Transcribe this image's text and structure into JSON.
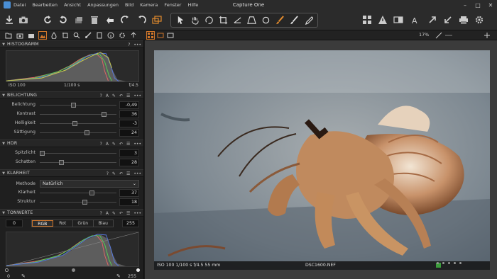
{
  "app": {
    "title": "Capture One"
  },
  "menu": [
    "Datei",
    "Bearbeiten",
    "Ansicht",
    "Anpassungen",
    "Bild",
    "Kamera",
    "Fenster",
    "Hilfe"
  ],
  "window_controls": {
    "minimize": "–",
    "maximize": "□",
    "close": "✕"
  },
  "toolbar": {
    "left_icons": [
      "import-icon",
      "camera-icon",
      "undo-icon",
      "redo-icon",
      "copy-icon",
      "trash-icon",
      "copy-adjustments-icon",
      "apply-adjustments-icon",
      "reset-icon",
      "apply-all-icon",
      "variants-icon"
    ],
    "cursor_tools": [
      "pointer-icon",
      "pan-icon",
      "rotate-icon",
      "crop-icon",
      "straighten-icon",
      "keystone-icon",
      "spot-icon",
      "circle-icon",
      "brush-icon",
      "eraser-icon",
      "picker-icon"
    ],
    "right_icons": [
      "grid-icon",
      "warning-icon",
      "compare-icon",
      "text-icon",
      "expand-icon",
      "collapse-icon",
      "print-icon",
      "settings-icon"
    ]
  },
  "toolstrip": {
    "tabs": [
      "folder-icon",
      "capture-icon",
      "camera-icon",
      "exposure-icon",
      "color-icon",
      "lens-icon",
      "crop-icon",
      "search-icon",
      "brush-icon",
      "clipboard-icon",
      "info-icon",
      "gear-icon",
      "export-icon",
      "more-icon"
    ],
    "zoom": "17%"
  },
  "histogram_section": {
    "title": "HISTOGRAMM",
    "iso": "ISO 100",
    "shutter": "1/100 s",
    "aperture": "f/4.5"
  },
  "exposure": {
    "title": "BELICHTUNG",
    "rows": [
      {
        "label": "Belichtung",
        "value": "-0,49",
        "pos": 0.44
      },
      {
        "label": "Kontrast",
        "value": "36",
        "pos": 0.84
      },
      {
        "label": "Helligkeit",
        "value": "-3",
        "pos": 0.46
      },
      {
        "label": "Sättigung",
        "value": "24",
        "pos": 0.62
      }
    ]
  },
  "hdr": {
    "title": "HDR",
    "rows": [
      {
        "label": "Spitzlicht",
        "value": "3",
        "pos": 0.03
      },
      {
        "label": "Schatten",
        "value": "28",
        "pos": 0.28
      }
    ]
  },
  "clarity": {
    "title": "KLARHEIT",
    "method_label": "Methode",
    "method_value": "Natürlich",
    "rows": [
      {
        "label": "Klarheit",
        "value": "37",
        "pos": 0.68
      },
      {
        "label": "Struktur",
        "value": "18",
        "pos": 0.59
      }
    ]
  },
  "levels": {
    "title": "TONWERTE",
    "low": "0",
    "high": "255",
    "tabs": [
      "RGB",
      "Rot",
      "Grün",
      "Blau"
    ],
    "active_tab": "RGB",
    "bottom_left": "0",
    "bottom_right": "255"
  },
  "viewer": {
    "info": "ISO 100  1/100 s  f/4.5  55 mm",
    "filename": "DSC1600.NEF"
  },
  "colors": {
    "accent": "#d0762a",
    "green_tag": "#3c9c3c"
  }
}
